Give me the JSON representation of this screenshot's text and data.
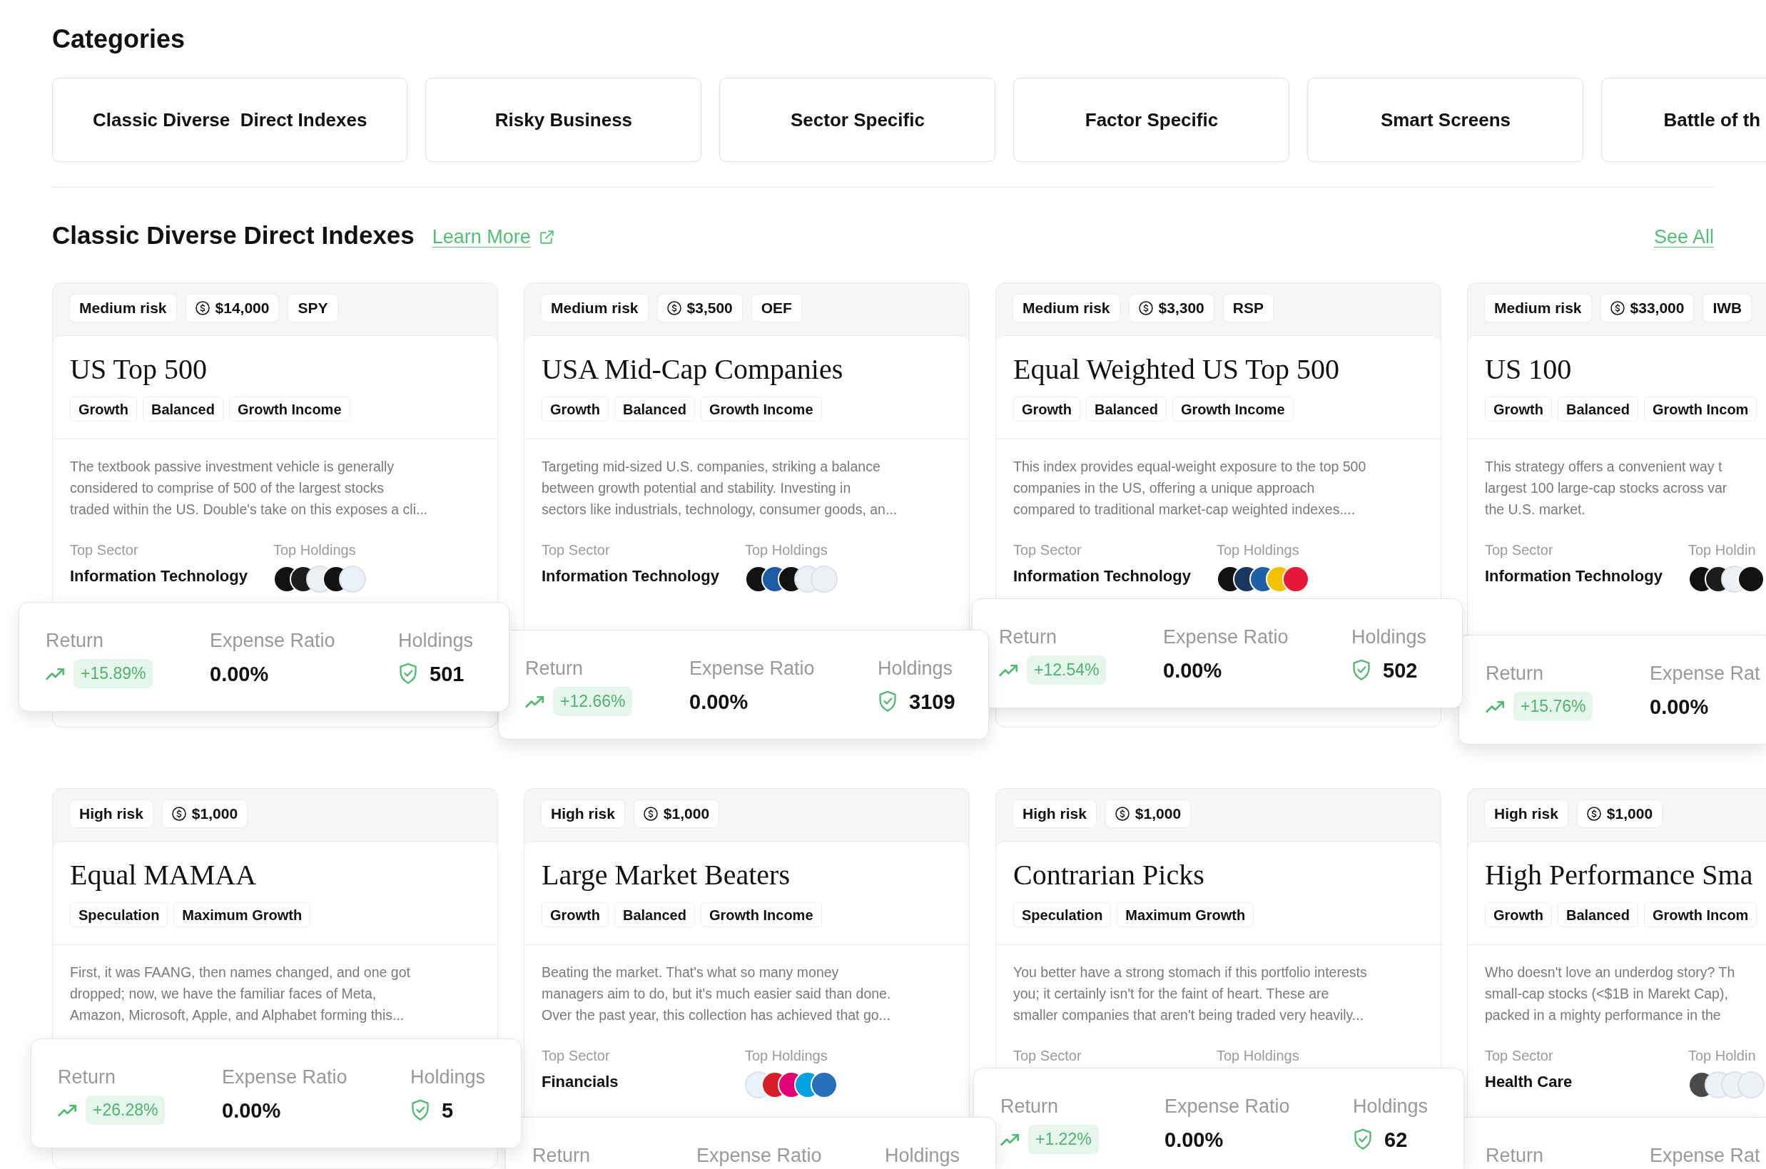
{
  "categories": {
    "title": "Categories",
    "items": [
      {
        "label": "Classic Diverse  Direct Indexes"
      },
      {
        "label": "Risky Business"
      },
      {
        "label": "Sector Specific"
      },
      {
        "label": "Factor Specific"
      },
      {
        "label": "Smart Screens"
      },
      {
        "label": "Battle of th"
      }
    ]
  },
  "section": {
    "title": "Classic Diverse Direct Indexes",
    "learn_more": "Learn More",
    "see_all": "See All"
  },
  "card_rows": [
    {
      "cards": [
        {
          "tags": [
            {
              "kind": "risk",
              "text": "Medium risk"
            },
            {
              "kind": "price",
              "text": "$14,000"
            },
            {
              "kind": "ticker",
              "text": "SPY"
            }
          ],
          "title": "US Top 500",
          "styles": [
            "Growth",
            "Balanced",
            "Growth Income"
          ],
          "description": [
            "The textbook passive investment vehicle is generally",
            "considered to comprise of 500 of the largest stocks",
            "traded within the US. Double's take on this exposes a cli..."
          ],
          "top_sector": {
            "label": "Top Sector",
            "value": "Information Technology"
          },
          "top_holdings": {
            "label": "Top Holdings",
            "logos": [
              {
                "color": "#111111"
              },
              {
                "color": "#1c1c1c"
              },
              {
                "color": "#eef1f4"
              },
              {
                "color": "#111111"
              },
              {
                "color": "#eaf1fb"
              }
            ]
          },
          "stats": [
            {
              "kind": "return",
              "label": "Return",
              "value": "+15.89%"
            },
            {
              "kind": "expense",
              "label": "Expense Ratio",
              "value": "0.00%"
            },
            {
              "kind": "holdings",
              "label": "Holdings",
              "value": "501"
            }
          ]
        },
        {
          "tags": [
            {
              "kind": "risk",
              "text": "Medium risk"
            },
            {
              "kind": "price",
              "text": "$3,500"
            },
            {
              "kind": "ticker",
              "text": "OEF"
            }
          ],
          "title": "USA Mid-Cap Companies",
          "styles": [
            "Growth",
            "Balanced",
            "Growth Income"
          ],
          "description": [
            "Targeting mid-sized U.S. companies, striking a balance",
            "between growth potential and stability. Investing in",
            "sectors like industrials, technology, consumer goods, an..."
          ],
          "top_sector": {
            "label": "Top Sector",
            "value": "Information Technology"
          },
          "top_holdings": {
            "label": "Top Holdings",
            "logos": [
              {
                "color": "#111111"
              },
              {
                "color": "#1e5ca8"
              },
              {
                "color": "#111111"
              },
              {
                "color": "#eef1f4"
              },
              {
                "color": "#eef1f4"
              }
            ]
          },
          "stats": [
            {
              "kind": "return",
              "label": "Return",
              "value": "+12.66%"
            },
            {
              "kind": "expense",
              "label": "Expense Ratio",
              "value": "0.00%"
            },
            {
              "kind": "holdings",
              "label": "Holdings",
              "value": "3109"
            }
          ]
        },
        {
          "tags": [
            {
              "kind": "risk",
              "text": "Medium risk"
            },
            {
              "kind": "price",
              "text": "$3,300"
            },
            {
              "kind": "ticker",
              "text": "RSP"
            }
          ],
          "title": "Equal Weighted US Top 500",
          "styles": [
            "Growth",
            "Balanced",
            "Growth Income"
          ],
          "description": [
            "This index provides equal-weight exposure to the top 500",
            "companies in the US, offering a unique approach",
            "compared to traditional market-cap weighted indexes...."
          ],
          "top_sector": {
            "label": "Top Sector",
            "value": "Information Technology"
          },
          "top_holdings": {
            "label": "Top Holdings",
            "logos": [
              {
                "color": "#111111"
              },
              {
                "color": "#17375e"
              },
              {
                "color": "#1f5fa6"
              },
              {
                "color": "#f2c200"
              },
              {
                "color": "#e31937"
              }
            ]
          },
          "stats": [
            {
              "kind": "return",
              "label": "Return",
              "value": "+12.54%"
            },
            {
              "kind": "expense",
              "label": "Expense Ratio",
              "value": "0.00%"
            },
            {
              "kind": "holdings",
              "label": "Holdings",
              "value": "502"
            }
          ]
        },
        {
          "tags": [
            {
              "kind": "risk",
              "text": "Medium risk"
            },
            {
              "kind": "price",
              "text": "$33,000"
            },
            {
              "kind": "ticker",
              "text": "IWB"
            }
          ],
          "title": "US 100",
          "styles": [
            "Growth",
            "Balanced",
            "Growth Incom"
          ],
          "description": [
            "This strategy offers a convenient way t",
            "largest 100 large-cap stocks across var",
            "the U.S. market."
          ],
          "top_sector": {
            "label": "Top Sector",
            "value": "Information Technology"
          },
          "top_holdings": {
            "label": "Top Holdin",
            "logos": [
              {
                "color": "#111111"
              },
              {
                "color": "#1c1c1c"
              },
              {
                "color": "#eef1f4"
              },
              {
                "color": "#111111"
              }
            ]
          },
          "stats": [
            {
              "kind": "return",
              "label": "Return",
              "value": "+15.76%"
            },
            {
              "kind": "expense",
              "label": "Expense Rat",
              "value": "0.00%"
            }
          ]
        }
      ]
    },
    {
      "cards": [
        {
          "tags": [
            {
              "kind": "risk",
              "text": "High risk"
            },
            {
              "kind": "price",
              "text": "$1,000"
            }
          ],
          "title": "Equal MAMAA",
          "styles": [
            "Speculation",
            "Maximum Growth"
          ],
          "description": [
            "First, it was FAANG, then names changed, and one got",
            "dropped; now, we have the familiar faces of Meta,",
            "Amazon, Microsoft, Apple, and Alphabet forming this..."
          ],
          "stats": [
            {
              "kind": "return",
              "label": "Return",
              "value": "+26.28%"
            },
            {
              "kind": "expense",
              "label": "Expense Ratio",
              "value": "0.00%"
            },
            {
              "kind": "holdings",
              "label": "Holdings",
              "value": "5"
            }
          ]
        },
        {
          "tags": [
            {
              "kind": "risk",
              "text": "High risk"
            },
            {
              "kind": "price",
              "text": "$1,000"
            }
          ],
          "title": "Large Market Beaters",
          "styles": [
            "Growth",
            "Balanced",
            "Growth Income"
          ],
          "description": [
            "Beating the market. That's what so many money",
            "managers aim to do, but it's much easier said than done.",
            "Over the past year, this collection has achieved that go..."
          ],
          "top_sector": {
            "label": "Top Sector",
            "value": "Financials"
          },
          "top_holdings": {
            "label": "Top Holdings",
            "logos": [
              {
                "color": "#eaf1fb"
              },
              {
                "color": "#d71e28"
              },
              {
                "color": "#e20074"
              },
              {
                "color": "#00a1e0"
              },
              {
                "color": "#2671b9"
              }
            ]
          },
          "stats": [
            {
              "kind": "return",
              "label": "Return"
            },
            {
              "kind": "expense",
              "label": "Expense Ratio"
            },
            {
              "kind": "holdings",
              "label": "Holdings"
            }
          ]
        },
        {
          "tags": [
            {
              "kind": "risk",
              "text": "High risk"
            },
            {
              "kind": "price",
              "text": "$1,000"
            }
          ],
          "title": "Contrarian Picks",
          "styles": [
            "Speculation",
            "Maximum Growth"
          ],
          "description": [
            "You better have a strong stomach if this portfolio interests",
            "you; it certainly isn't for the faint of heart. These are",
            "smaller companies that aren't being traded very heavily..."
          ],
          "top_sector": {
            "label": "Top Sector"
          },
          "top_holdings": {
            "label": "Top Holdings"
          },
          "stats": [
            {
              "kind": "return",
              "label": "Return",
              "value": "+1.22%"
            },
            {
              "kind": "expense",
              "label": "Expense Ratio",
              "value": "0.00%"
            },
            {
              "kind": "holdings",
              "label": "Holdings",
              "value": "62"
            }
          ]
        },
        {
          "tags": [
            {
              "kind": "risk",
              "text": "High risk"
            },
            {
              "kind": "price",
              "text": "$1,000"
            }
          ],
          "title": "High Performance Sma",
          "styles": [
            "Growth",
            "Balanced",
            "Growth Incom"
          ],
          "description": [
            "Who doesn't love an underdog story? Th",
            "small-cap stocks (<$1B in Marekt Cap),",
            "packed in a mighty performance in the"
          ],
          "top_sector": {
            "label": "Top Sector",
            "value": "Health Care"
          },
          "top_holdings": {
            "label": "Top Holdin",
            "logos": [
              {
                "color": "#4a4a4a"
              },
              {
                "color": "#eef2f7"
              },
              {
                "color": "#eef2f7"
              },
              {
                "color": "#eef2f7"
              }
            ]
          },
          "stats": [
            {
              "kind": "return",
              "label": "Return"
            },
            {
              "kind": "expense",
              "label": "Expense Rat"
            }
          ]
        }
      ]
    }
  ]
}
